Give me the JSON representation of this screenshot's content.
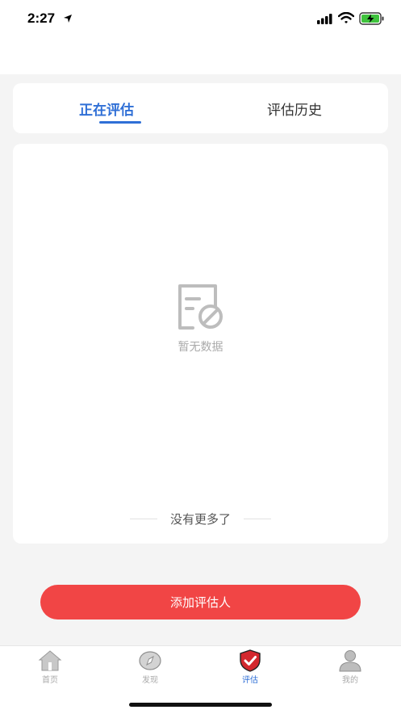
{
  "status_bar": {
    "time": "2:27"
  },
  "tabs": {
    "active_label": "正在评估",
    "history_label": "评估历史"
  },
  "empty_state": {
    "message": "暂无数据",
    "footer": "没有更多了"
  },
  "add_button_label": "添加评估人",
  "tab_bar": [
    {
      "label": "首页",
      "icon": "home-icon"
    },
    {
      "label": "发现",
      "icon": "compass-icon"
    },
    {
      "label": "评估",
      "icon": "shield-check-icon"
    },
    {
      "label": "我的",
      "icon": "user-icon"
    }
  ],
  "colors": {
    "accent": "#2f6fd6",
    "button": "#f14545",
    "shield": "#d3282e"
  }
}
